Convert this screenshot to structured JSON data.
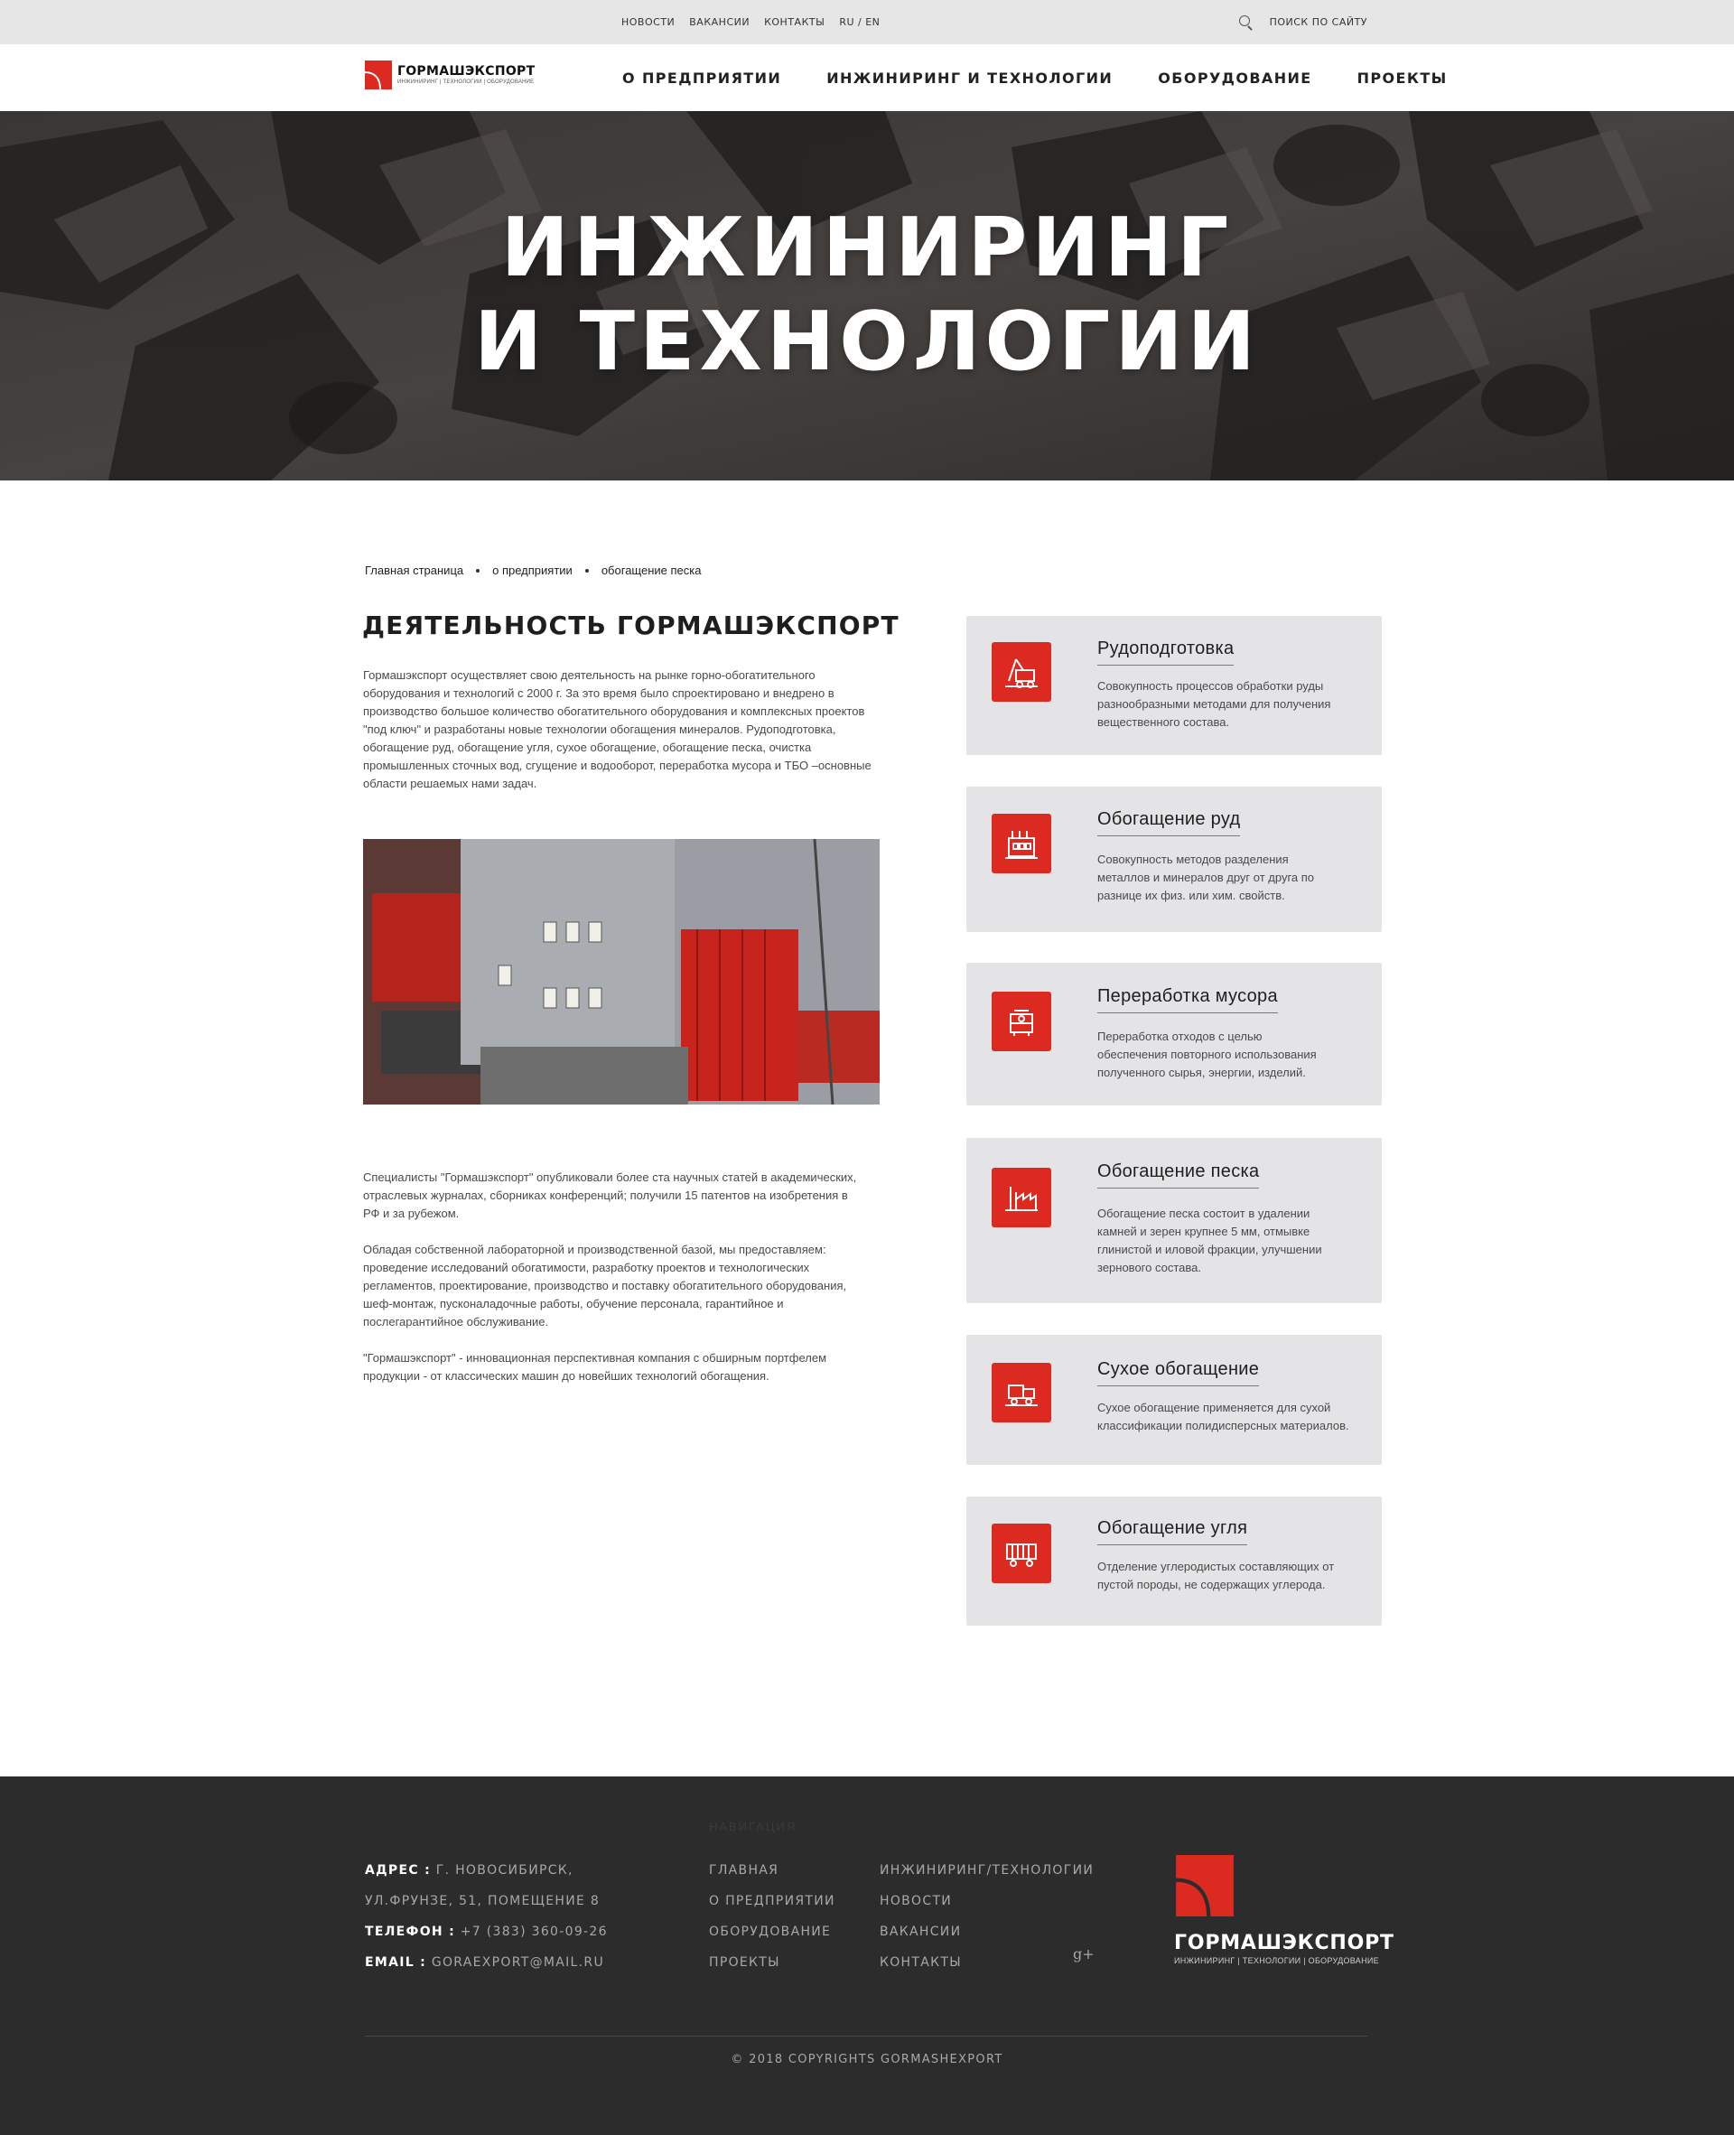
{
  "topbar": {
    "nav": [
      "НОВОСТИ",
      "ВАКАНСИИ",
      "КОНТАКТЫ",
      "RU / EN"
    ],
    "search_label": "ПОИСК ПО САЙТУ",
    "search_icon": "search-icon"
  },
  "header": {
    "logo_name": "ГОРМАШЭКСПОРТ",
    "logo_tagline": "ИНЖИНИРИНГ | ТЕХНОЛОГИИ | ОБОРУДОВАНИЕ",
    "nav": [
      "О ПРЕДПРИЯТИИ",
      "ИНЖИНИРИНГ И ТЕХНОЛОГИИ",
      "ОБОРУДОВАНИЕ",
      "ПРОЕКТЫ"
    ]
  },
  "hero": {
    "line1": "ИНЖИНИРИНГ",
    "line2": "И ТЕХНОЛОГИИ"
  },
  "breadcrumb": [
    "Главная страница",
    "о предприятии",
    "обогащение песка"
  ],
  "main": {
    "title": "ДЕЯТЕЛЬНОСТЬ ГОРМАШЭКСПОРТ",
    "intro": "Гормашэкспорт осуществляет свою деятельность на рынке горно-обогатительного\nоборудования и технологий с 2000 г. За это время было спроектировано и внедрено в\nпроизводство большое количество обогатительного оборудования и комплексных проектов\n\"под ключ\" и разработаны новые технологии обогащения минералов. Рудоподготовка,\nобогащение руд, обогащение угля, сухое обогащение, обогащение песка, очистка\nпромышленных сточных вод, сгущение и водооборот, переработка мусора и ТБО –основные\nобласти решаемых нами задач.",
    "para2": "Специалисты  \"Гормашэкспорт\" опубликовали более ста научных статей в академических,\nотраслевых журналах, сборниках конференций; получили 15 патентов на изобретения в\nРФ и за рубежом.",
    "para3": "Обладая собственной лабораторной и производственной базой, мы предоставляем:\nпроведение исследований обогатимости, разработку проектов и технологических\nрегламентов, проектирование, производство и поставку обогатительного оборудования,\nшеф-монтаж, пусконаладочные работы, обучение персонала, гарантийное и\nпослегарантийное обслуживание.",
    "para4": "\"Гормашэкспорт\" - инновационная перспективная компания с обширным портфелем\nпродукции - от классических машин до новейших технологий обогащения."
  },
  "cards": [
    {
      "title": "Рудоподготовка",
      "desc": "Совокупность процессов обработки руды\nразнообразными методами для получения\nвещественного состава.",
      "icon": "excavator-icon"
    },
    {
      "title": "Обогащение руд",
      "desc": "Совокупность методов разделения\nметаллов и минералов друг от друга по\nразнице их физ. или хим. свойств.",
      "icon": "factory-icon"
    },
    {
      "title": "Переработка мусора",
      "desc": "Переработка отходов с целью\nобеспечения повторного использования\nполученного сырья, энергии, изделий.",
      "icon": "recycling-machine-icon"
    },
    {
      "title": "Обогащение песка",
      "desc": "Обогащение песка состоит в удалении\n камней и зерен крупнее 5 мм, отмывке\nглинистой и иловой фракции, улучшении\nзернового состава.",
      "icon": "plant-chimney-icon"
    },
    {
      "title": "Сухое обогащение",
      "desc": "Сухое обогащение применяется для сухой\nклассификации полидисперсных материалов.",
      "icon": "dry-separator-icon"
    },
    {
      "title": "Обогащение угля",
      "desc": "Отделение углеродистых составляющих от\nпустой породы,  не содержащих углерода.",
      "icon": "coal-wagon-icon"
    }
  ],
  "footer": {
    "ghost_label": "НАВИГАЦИЯ",
    "address_label": "АДРЕС :",
    "address_value": "Г. НОВОСИБИРСК,",
    "address_line2": "УЛ.ФРУНЗЕ, 51, ПОМЕЩЕНИЕ 8",
    "phone_label": "ТЕЛЕФОН :",
    "phone_value": "+7 (383) 360-09-26",
    "email_label": "EMAIL :",
    "email_value": "GORAEXPORT@MAIL.RU",
    "links_col1": [
      "ГЛАВНАЯ",
      "О ПРЕДПРИЯТИИ",
      "ОБОРУДОВАНИЕ",
      "ПРОЕКТЫ"
    ],
    "links_col2": [
      "ИНЖИНИРИНГ/ТЕХНОЛОГИИ",
      "НОВОСТИ",
      "ВАКАНСИИ",
      "КОНТАКТЫ"
    ],
    "social_glyph": "g+",
    "logo_name": "ГОРМАШЭКСПОРТ",
    "logo_tagline": "ИНЖИНИРИНГ | ТЕХНОЛОГИИ | ОБОРУДОВАНИЕ",
    "copyright": "© 2018 COPYRIGHTS GORMASHEXPORT"
  },
  "colors": {
    "accent": "#dc2a20",
    "card_bg": "#e4e4e7",
    "footer_bg": "#2c2c2c",
    "topbar_bg": "#e6e6e6"
  }
}
